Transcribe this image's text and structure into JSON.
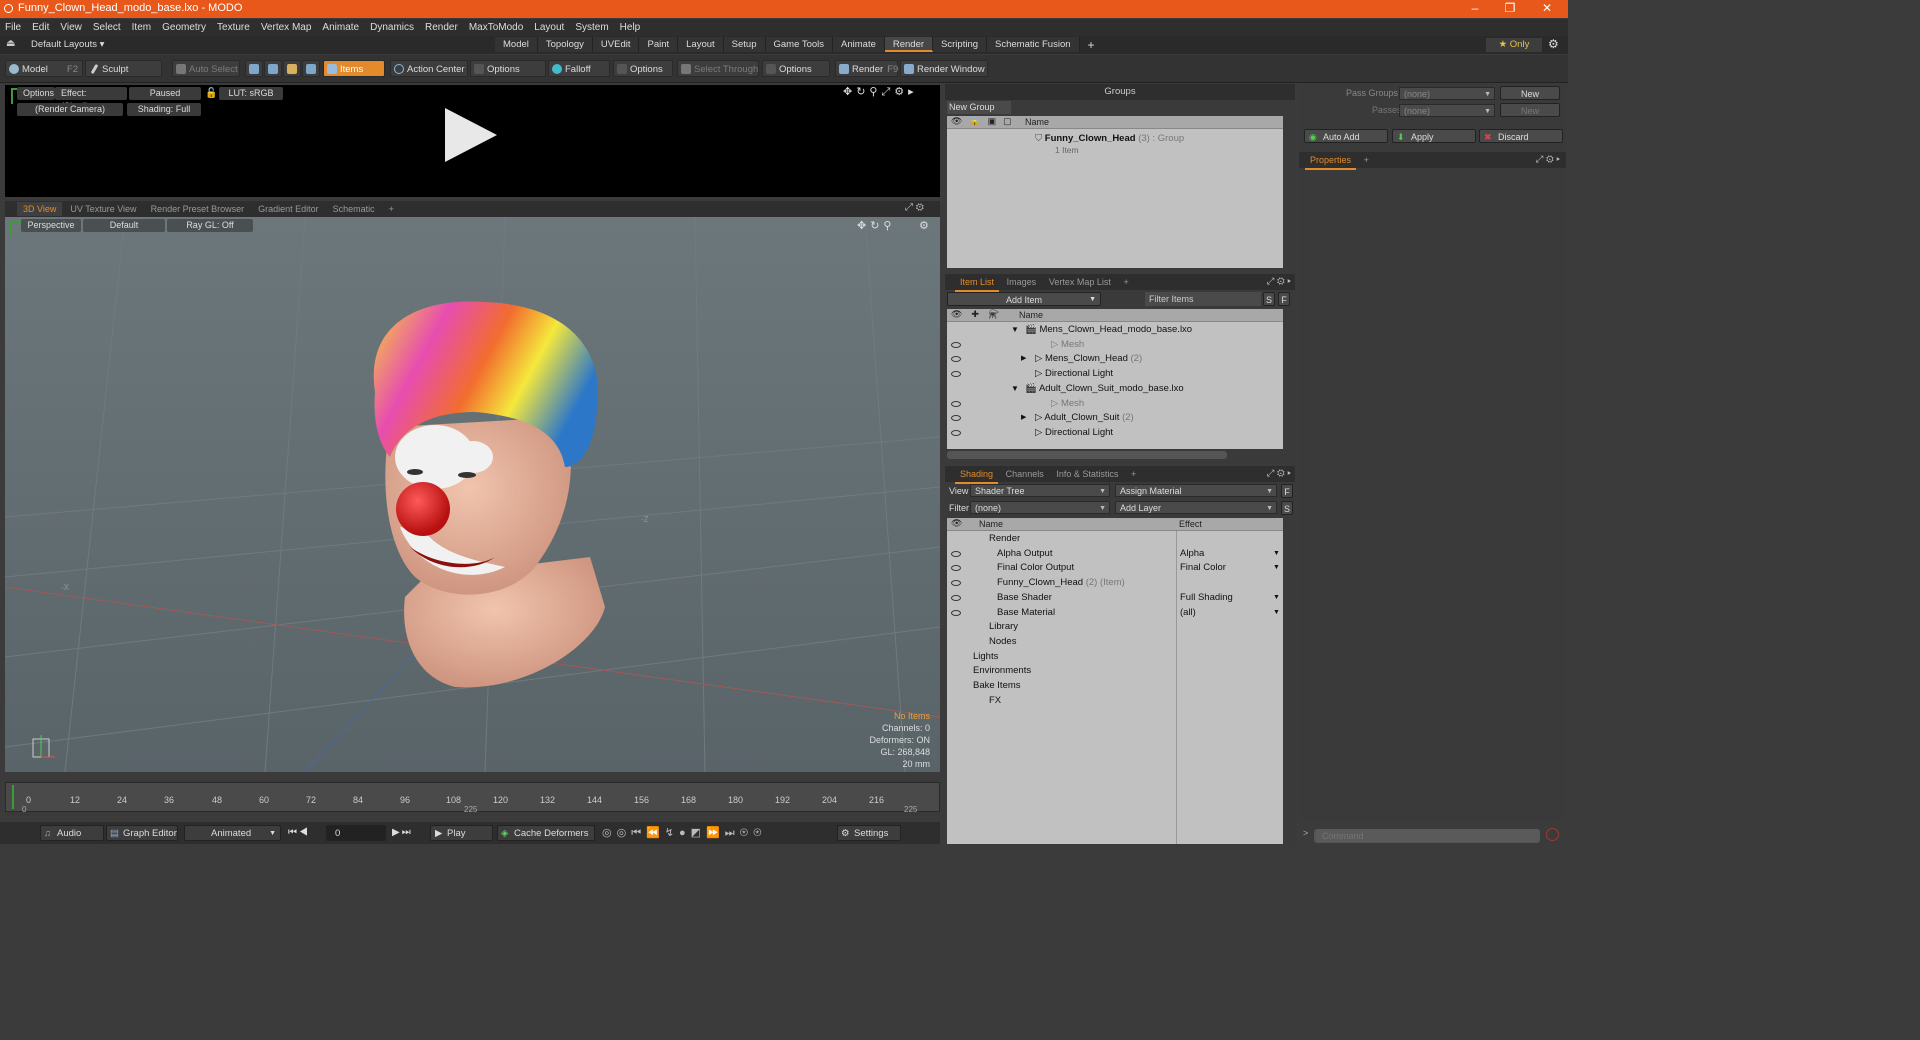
{
  "window": {
    "title": "Funny_Clown_Head_modo_base.lxo - MODO",
    "min": "–",
    "max": "❐",
    "close": "✕"
  },
  "menu": [
    "File",
    "Edit",
    "View",
    "Select",
    "Item",
    "Geometry",
    "Texture",
    "Vertex Map",
    "Animate",
    "Dynamics",
    "Render",
    "MaxToModo",
    "Layout",
    "System",
    "Help"
  ],
  "layouts": {
    "preset": "Default Layouts ▾",
    "tabs": [
      "Model",
      "Topology",
      "UVEdit",
      "Paint",
      "Layout",
      "Setup",
      "Game Tools",
      "Animate",
      "Render",
      "Scripting",
      "Schematic Fusion"
    ],
    "active": "Render",
    "add": "+",
    "only": "★  Only",
    "gear": "⚙"
  },
  "toolbar": {
    "model": "Model",
    "model_key": "F2",
    "sculpt": "Sculpt",
    "auto_select": "Auto Select",
    "items": "Items",
    "action_center": "Action Center",
    "options1": "Options",
    "falloff": "Falloff",
    "options2": "Options",
    "select_through": "Select Through",
    "options3": "Options",
    "render": "Render",
    "render_key": "F9",
    "render_window": "Render Window"
  },
  "preview": {
    "options": "Options",
    "effect": "Effect: (Shadi...",
    "paused": "Paused",
    "lut": "LUT: sRGB",
    "camera": "(Render Camera)",
    "shading": "Shading: Full"
  },
  "viewport_tabs": [
    "3D View",
    "UV Texture View",
    "Render Preset Browser",
    "Gradient Editor",
    "Schematic",
    "+"
  ],
  "viewport": {
    "perspective": "Perspective",
    "default": "Default",
    "raygl": "Ray GL: Off",
    "stats": {
      "items": "No Items",
      "channels": "Channels: 0",
      "deformers": "Deformers: ON",
      "gl": "GL: 268,848",
      "size": "20 mm"
    },
    "axis_x": "-X",
    "axis_z": "-Z"
  },
  "timeline": {
    "ticks": [
      "0",
      "12",
      "24",
      "36",
      "48",
      "60",
      "72",
      "84",
      "96",
      "108",
      "120",
      "132",
      "144",
      "156",
      "168",
      "180",
      "192",
      "204",
      "216"
    ],
    "mid": "225",
    "end": "225",
    "start": "0"
  },
  "bottom": {
    "audio": "Audio",
    "graph_editor": "Graph Editor",
    "animated": "Animated",
    "frame": "0",
    "play": "Play",
    "cache": "Cache Deformers",
    "settings": "Settings"
  },
  "groups": {
    "title": "Groups",
    "new_group": "New Group",
    "col_name": "Name",
    "row_name": "Funny_Clown_Head",
    "row_count": "(3)",
    "row_type": ": Group",
    "row_sub": "1 Item"
  },
  "passes": {
    "pass_groups": "Pass Groups",
    "passes": "Passes",
    "none1": "(none)",
    "none2": "(none)",
    "new1": "New",
    "new2": "New",
    "auto_add": "Auto Add",
    "apply": "Apply",
    "discard": "Discard",
    "properties": "Properties",
    "add": "+"
  },
  "itemlist": {
    "tabs": [
      "Item List",
      "Images",
      "Vertex Map List",
      "+"
    ],
    "add_item": "Add Item",
    "filter": "Filter Items",
    "s": "S",
    "f": "F",
    "col_name": "Name",
    "rows": [
      {
        "label": "Mens_Clown_Head_modo_base.lxo",
        "extra": "",
        "dim": false,
        "indent": 0
      },
      {
        "label": "Mesh",
        "extra": "",
        "dim": true,
        "indent": 2
      },
      {
        "label": "Mens_Clown_Head",
        "extra": "(2)",
        "dim": false,
        "indent": 2
      },
      {
        "label": "Directional Light",
        "extra": "",
        "dim": false,
        "indent": 2
      },
      {
        "label": "Adult_Clown_Suit_modo_base.lxo",
        "extra": "",
        "dim": false,
        "indent": 0
      },
      {
        "label": "Mesh",
        "extra": "",
        "dim": true,
        "indent": 2
      },
      {
        "label": "Adult_Clown_Suit",
        "extra": "(2)",
        "dim": false,
        "indent": 2
      },
      {
        "label": "Directional Light",
        "extra": "",
        "dim": false,
        "indent": 2
      }
    ]
  },
  "shading": {
    "tabs": [
      "Shading",
      "Channels",
      "Info & Statistics",
      "+"
    ],
    "view_label": "View",
    "view_value": "Shader Tree",
    "assign": "Assign Material",
    "filter_label": "Filter",
    "filter_value": "(none)",
    "add_layer": "Add Layer",
    "f": "F",
    "s": "S",
    "col_name": "Name",
    "col_effect": "Effect",
    "rows": [
      {
        "label": "Render",
        "extra": "",
        "effect": ""
      },
      {
        "label": "Alpha Output",
        "extra": "",
        "effect": "Alpha"
      },
      {
        "label": "Final Color Output",
        "extra": "",
        "effect": "Final Color"
      },
      {
        "label": "Funny_Clown_Head",
        "extra": "(2) (Item)",
        "effect": ""
      },
      {
        "label": "Base Shader",
        "extra": "",
        "effect": "Full Shading"
      },
      {
        "label": "Base Material",
        "extra": "",
        "effect": "(all)"
      },
      {
        "label": "Library",
        "extra": "",
        "effect": ""
      },
      {
        "label": "Nodes",
        "extra": "",
        "effect": ""
      },
      {
        "label": "Lights",
        "extra": "",
        "effect": ""
      },
      {
        "label": "Environments",
        "extra": "",
        "effect": ""
      },
      {
        "label": "Bake Items",
        "extra": "",
        "effect": ""
      },
      {
        "label": "FX",
        "extra": "",
        "effect": ""
      }
    ]
  },
  "command": {
    "placeholder": "Command"
  },
  "colors": {
    "accent": "#e38b2c",
    "titlebar": "#e8581b"
  }
}
